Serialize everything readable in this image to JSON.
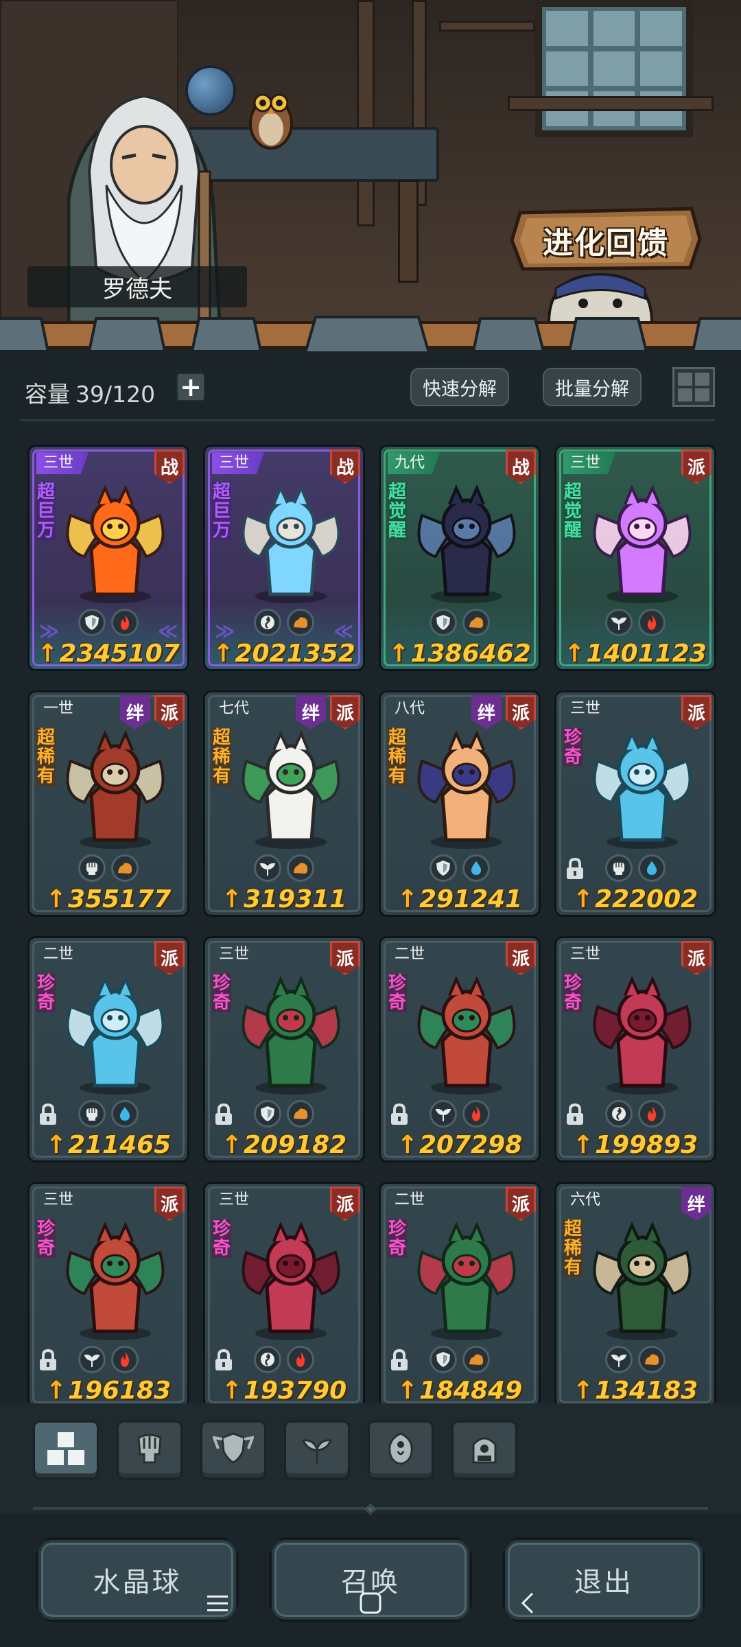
{
  "scene": {
    "npc_name": "罗德夫",
    "feedback_button_label": "进化回馈"
  },
  "toolbar": {
    "capacity_label": "容量",
    "capacity_value": "39/120",
    "add_capacity_icon": "plus-icon",
    "quick_decompose_label": "快速分解",
    "batch_decompose_label": "批量分解",
    "view_toggle_icon": "grid-view-icon"
  },
  "cards": [
    {
      "gen": "三世",
      "rarity": "超巨万",
      "rarity_color": "#b05cff",
      "theme": "purple",
      "badges": [
        "战"
      ],
      "elements": [
        "shield-icon",
        "fire-icon"
      ],
      "power": "2345107",
      "locked": false,
      "art": "fire-demon"
    },
    {
      "gen": "三世",
      "rarity": "超巨万",
      "rarity_color": "#b05cff",
      "theme": "purple",
      "badges": [
        "战"
      ],
      "elements": [
        "spirit-icon",
        "earth-icon"
      ],
      "power": "2021352",
      "locked": false,
      "art": "ice-dragon"
    },
    {
      "gen": "九代",
      "rarity": "超觉醒",
      "rarity_color": "#45e0a0",
      "theme": "green",
      "badges": [
        "战"
      ],
      "elements": [
        "shield-icon",
        "earth-icon"
      ],
      "power": "1386462",
      "locked": false,
      "art": "dark-sorceress"
    },
    {
      "gen": "三世",
      "rarity": "超觉醒",
      "rarity_color": "#45e0a0",
      "theme": "green",
      "badges": [
        "派"
      ],
      "elements": [
        "leaf-icon",
        "fire-icon"
      ],
      "power": "1401123",
      "locked": false,
      "art": "butterfly-fairy"
    },
    {
      "gen": "一世",
      "rarity": "超稀有",
      "rarity_color": "#ffb02a",
      "theme": "plain",
      "badges": [
        "绊",
        "派"
      ],
      "elements": [
        "fist-icon",
        "earth-icon"
      ],
      "power": "355177",
      "locked": false,
      "art": "mushroom-beast"
    },
    {
      "gen": "七代",
      "rarity": "超稀有",
      "rarity_color": "#ffb02a",
      "theme": "plain",
      "badges": [
        "绊",
        "派"
      ],
      "elements": [
        "leaf-icon",
        "earth-icon"
      ],
      "power": "319311",
      "locked": false,
      "art": "owl-monk"
    },
    {
      "gen": "八代",
      "rarity": "超稀有",
      "rarity_color": "#ffb02a",
      "theme": "plain",
      "badges": [
        "绊",
        "派"
      ],
      "elements": [
        "shield-icon",
        "water-icon"
      ],
      "power": "291241",
      "locked": false,
      "art": "bunny-witch"
    },
    {
      "gen": "三世",
      "rarity": "珍奇",
      "rarity_color": "#ff4fd0",
      "theme": "plain",
      "badges": [
        "派"
      ],
      "elements": [
        "fist-icon",
        "water-icon"
      ],
      "power": "222002",
      "locked": true,
      "art": "water-spirit"
    },
    {
      "gen": "二世",
      "rarity": "珍奇",
      "rarity_color": "#ff4fd0",
      "theme": "plain",
      "badges": [
        "派"
      ],
      "elements": [
        "fist-icon",
        "water-icon"
      ],
      "power": "211465",
      "locked": true,
      "art": "water-spirit"
    },
    {
      "gen": "三世",
      "rarity": "珍奇",
      "rarity_color": "#ff4fd0",
      "theme": "plain",
      "badges": [
        "派"
      ],
      "elements": [
        "shield-icon",
        "earth-icon"
      ],
      "power": "209182",
      "locked": true,
      "art": "plant-dryad"
    },
    {
      "gen": "二世",
      "rarity": "珍奇",
      "rarity_color": "#ff4fd0",
      "theme": "plain",
      "badges": [
        "派"
      ],
      "elements": [
        "leaf-icon",
        "fire-icon"
      ],
      "power": "207298",
      "locked": true,
      "art": "moth-fairy"
    },
    {
      "gen": "三世",
      "rarity": "珍奇",
      "rarity_color": "#ff4fd0",
      "theme": "plain",
      "badges": [
        "派"
      ],
      "elements": [
        "spirit-icon",
        "fire-icon"
      ],
      "power": "199893",
      "locked": true,
      "art": "red-dragon"
    },
    {
      "gen": "三世",
      "rarity": "珍奇",
      "rarity_color": "#ff4fd0",
      "theme": "plain",
      "badges": [
        "派"
      ],
      "elements": [
        "leaf-icon",
        "fire-icon"
      ],
      "power": "196183",
      "locked": true,
      "art": "moth-fairy"
    },
    {
      "gen": "三世",
      "rarity": "珍奇",
      "rarity_color": "#ff4fd0",
      "theme": "plain",
      "badges": [
        "派"
      ],
      "elements": [
        "spirit-icon",
        "fire-icon"
      ],
      "power": "193790",
      "locked": true,
      "art": "red-dragon"
    },
    {
      "gen": "二世",
      "rarity": "珍奇",
      "rarity_color": "#ff4fd0",
      "theme": "plain",
      "badges": [
        "派"
      ],
      "elements": [
        "shield-icon",
        "earth-icon"
      ],
      "power": "184849",
      "locked": true,
      "art": "plant-dryad"
    },
    {
      "gen": "六代",
      "rarity": "超稀有",
      "rarity_color": "#ffb02a",
      "theme": "plain",
      "badges": [
        "绊"
      ],
      "elements": [
        "leaf-icon",
        "earth-icon"
      ],
      "power": "134183",
      "locked": false,
      "art": "moss-golem"
    }
  ],
  "filters": [
    "all-icon",
    "fist-icon",
    "shield-icon",
    "leaf-icon",
    "spirit-icon",
    "tower-icon"
  ],
  "bottom_buttons": {
    "crystal_ball": "水晶球",
    "summon": "召唤",
    "exit": "退出"
  },
  "system_nav": [
    "menu-icon",
    "home-icon",
    "back-icon"
  ]
}
